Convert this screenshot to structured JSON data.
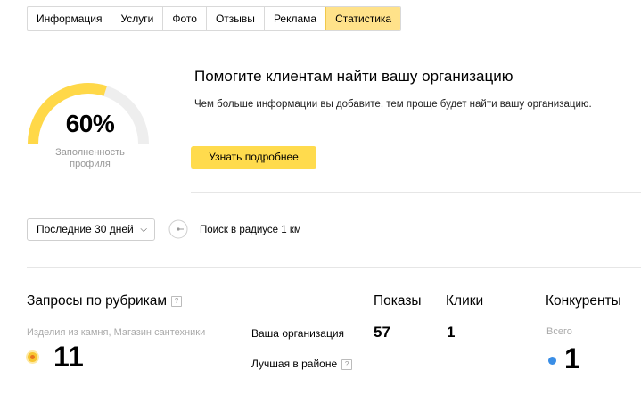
{
  "tabs": [
    "Информация",
    "Услуги",
    "Фото",
    "Отзывы",
    "Реклама",
    "Статистика"
  ],
  "active_tab_index": 5,
  "profile": {
    "completeness_percent": 60,
    "percent_label": "60%",
    "caption": "Заполненность профиля"
  },
  "promo": {
    "title": "Помогите клиентам найти вашу организацию",
    "text": "Чем больше информации вы добавите, тем проще будет найти вашу организацию.",
    "button_label": "Узнать подробнее"
  },
  "filters": {
    "period_label": "Последние 30 дней",
    "radius_label": "Поиск в радиусе 1 км"
  },
  "requests": {
    "title": "Запросы по рубрикам",
    "help": "?",
    "rubrics": "Изделия из камня, Магазин сантехники",
    "count": "11"
  },
  "table": {
    "col_shows": "Показы",
    "col_clicks": "Клики",
    "row_org": "Ваша организация",
    "row_best": "Лучшая в районе",
    "help": "?",
    "org_shows": "57",
    "org_clicks": "1"
  },
  "competitors": {
    "title": "Конкуренты",
    "sub": "Всего",
    "count": "1"
  },
  "colors": {
    "accent_yellow": "#ffdb4d",
    "active_tab": "#ffe28a",
    "gauge_fill": "#ffd848",
    "gauge_track": "#eeeeee",
    "competitor_dot": "#3a8ee6"
  }
}
